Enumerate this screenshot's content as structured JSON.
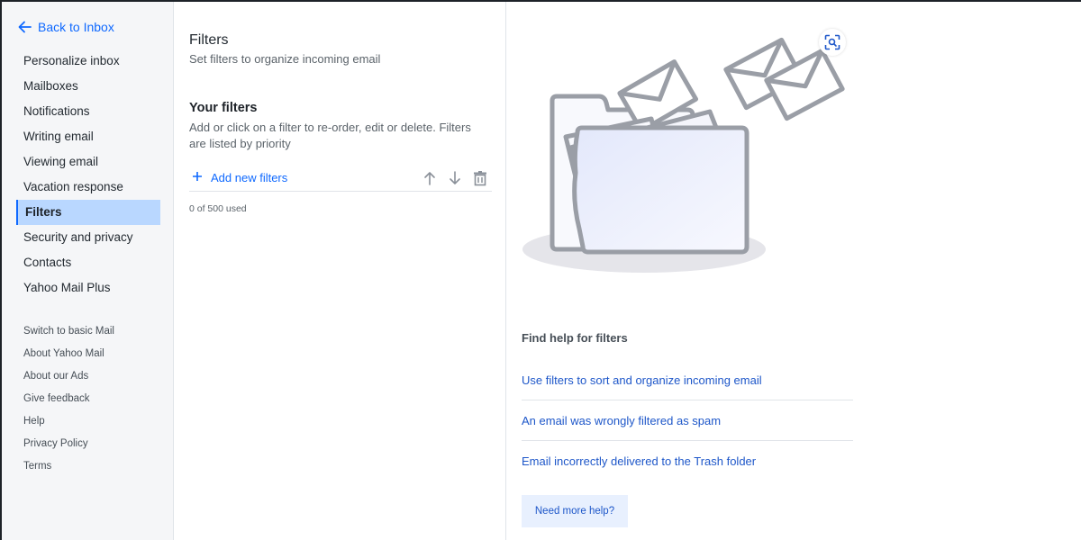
{
  "sidebar": {
    "back_label": "Back to Inbox",
    "items": [
      {
        "label": "Personalize inbox"
      },
      {
        "label": "Mailboxes"
      },
      {
        "label": "Notifications"
      },
      {
        "label": "Writing email"
      },
      {
        "label": "Viewing email"
      },
      {
        "label": "Vacation response"
      },
      {
        "label": "Filters",
        "active": true
      },
      {
        "label": "Security and privacy"
      },
      {
        "label": "Contacts"
      },
      {
        "label": "Yahoo Mail Plus"
      }
    ],
    "secondary": [
      {
        "label": "Switch to basic Mail"
      },
      {
        "label": "About Yahoo Mail"
      },
      {
        "label": "About our Ads"
      },
      {
        "label": "Give feedback"
      },
      {
        "label": "Help"
      },
      {
        "label": "Privacy Policy"
      },
      {
        "label": "Terms"
      }
    ]
  },
  "filters": {
    "title": "Filters",
    "subtitle": "Set filters to organize incoming email",
    "section_title": "Your filters",
    "description": "Add or click on a filter to re-order, edit or delete. Filters are listed by priority",
    "add_label": "Add new filters",
    "usage": "0 of 500 used",
    "icons": [
      "plus-icon",
      "arrow-up-icon",
      "arrow-down-icon",
      "trash-icon"
    ]
  },
  "help": {
    "title": "Find help for filters",
    "links": [
      {
        "label": "Use filters to sort and organize incoming email"
      },
      {
        "label": "An email was wrongly filtered as spam"
      },
      {
        "label": "Email incorrectly delivered to the Trash folder"
      }
    ],
    "more_label": "Need more help?"
  },
  "colors": {
    "accent": "#0f69ff",
    "link": "#1e57c9",
    "active_nav_bg": "#b9d7ff",
    "sidebar_bg": "#f5f6f8"
  }
}
